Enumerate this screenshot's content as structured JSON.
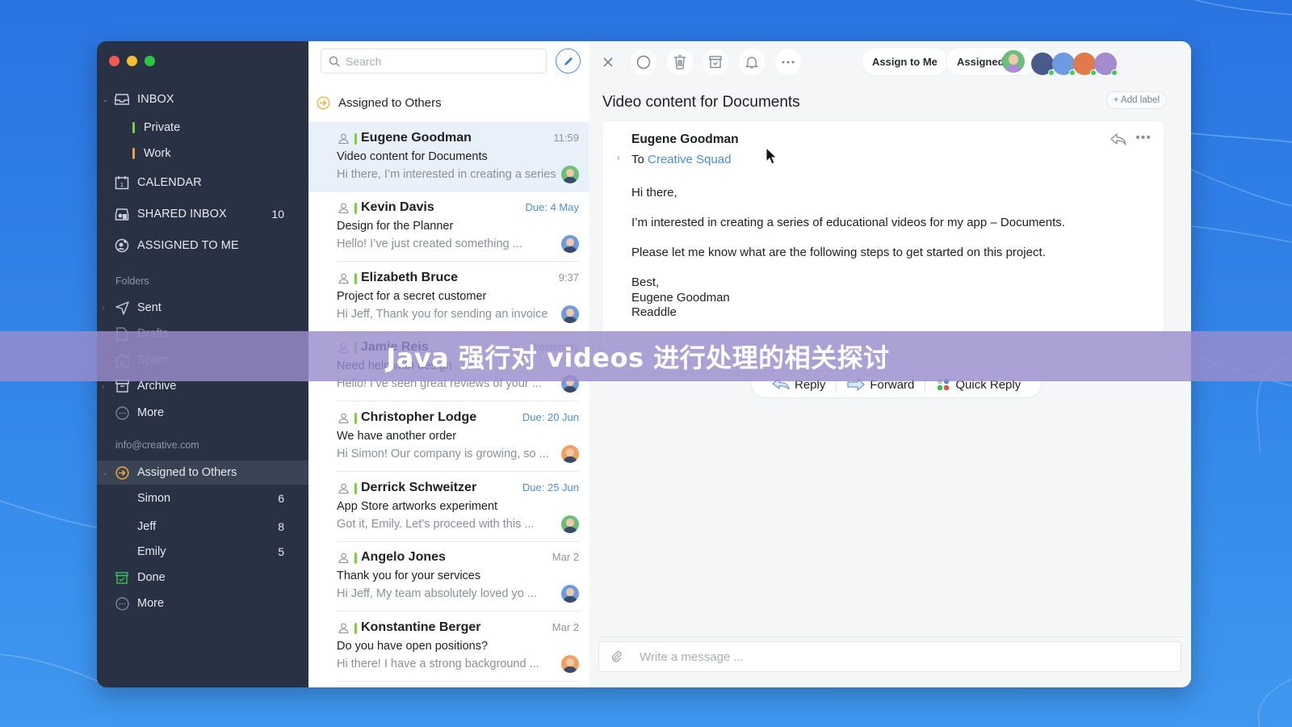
{
  "window": {
    "traffic_lights": [
      "close",
      "minimize",
      "maximize"
    ]
  },
  "sidebar": {
    "main": [
      {
        "label": "INBOX",
        "icon": "inbox-icon",
        "expanded": true
      },
      {
        "label": "Private",
        "tag_color": "#7fcf3a"
      },
      {
        "label": "Work",
        "tag_color": "#f0a03a"
      },
      {
        "label": "CALENDAR",
        "icon": "calendar-icon"
      },
      {
        "label": "SHARED INBOX",
        "icon": "shared-inbox-icon",
        "count": "10"
      },
      {
        "label": "ASSIGNED TO ME",
        "icon": "assigned-to-me-icon"
      }
    ],
    "folders_title": "Folders",
    "folders": [
      {
        "label": "Sent",
        "icon": "send-icon"
      },
      {
        "label": "Drafts",
        "icon": "draft-icon"
      },
      {
        "label": "Spam",
        "icon": "spam-icon"
      },
      {
        "label": "Archive",
        "icon": "archive-icon"
      },
      {
        "label": "More",
        "icon": "more-circle-icon"
      }
    ],
    "account_title": "info@creative.com",
    "account": [
      {
        "label": "Assigned to Others",
        "icon": "assigned-others-icon",
        "active": true
      },
      {
        "label": "Simon",
        "count": "6"
      },
      {
        "label": "Jeff",
        "count": "8"
      },
      {
        "label": "Emily",
        "count": "5"
      },
      {
        "label": "Done",
        "icon": "done-icon"
      },
      {
        "label": "More",
        "icon": "more-circle-icon"
      }
    ]
  },
  "list": {
    "search_placeholder": "Search",
    "header": "Assigned to Others",
    "messages": [
      {
        "name": "Eugene Goodman",
        "time": "11:59",
        "due": false,
        "subject": "Video content for Documents",
        "preview": "Hi there, I’m interested in creating a series",
        "selected": true,
        "avatar_color": "#6bbf7a"
      },
      {
        "name": "Kevin Davis",
        "time": "Due: 4 May",
        "due": true,
        "subject": "Design for the Planner",
        "preview": "Hello! I’ve just created something ...",
        "avatar_color": "#6e9be0"
      },
      {
        "name": "Elizabeth Bruce",
        "time": "9:37",
        "due": false,
        "subject": "Project for a secret customer",
        "preview": "Hi Jeff, Thank you for sending an invoice",
        "avatar_color": "#6e9be0"
      },
      {
        "name": "Jamie Reis",
        "time": "Yesterday",
        "due": false,
        "subject": "Need help with design",
        "preview": "Hello! I’ve seen great reviews of your ...",
        "avatar_color": "#6e9be0"
      },
      {
        "name": "Christopher Lodge",
        "time": "Due: 20 Jun",
        "due": true,
        "subject": "We have another order",
        "preview": "Hi Simon! Our company is growing, so ...",
        "avatar_color": "#f0a060"
      },
      {
        "name": "Derrick Schweitzer",
        "time": "Due: 25 Jun",
        "due": true,
        "subject": "App Store artworks experiment",
        "preview": "Got it, Emily. Let’s proceed with this ...",
        "avatar_color": "#6bbf7a"
      },
      {
        "name": "Angelo Jones",
        "time": "Mar 2",
        "due": false,
        "subject": "Thank you for your services",
        "preview": "Hi Jeff, My team absolutely loved yo ...",
        "avatar_color": "#6e9be0"
      },
      {
        "name": "Konstantine Berger",
        "time": "Mar 2",
        "due": false,
        "subject": "Do you have open positions?",
        "preview": "Hi there! I have a strong background ...",
        "avatar_color": "#f0a060"
      }
    ]
  },
  "detail": {
    "toolbar": {
      "close_icon": "close-icon",
      "mark_icon": "circle-icon",
      "delete_icon": "trash-icon",
      "archive_icon": "archive-icon",
      "remind_icon": "bell-icon",
      "more_icon": "more-icon",
      "assign_to_me": "Assign to Me",
      "assigned": "Assigned"
    },
    "assignee_colors": [
      "#6bbf7a",
      "#4a5a8a",
      "#6e9be0",
      "#e07a4a",
      "#a58ad0"
    ],
    "subject": "Video content for Documents",
    "add_label": "+ Add label",
    "from": "Eugene Goodman",
    "to_prefix": "To",
    "to": "Creative Squad",
    "body": [
      "Hi there,",
      "I’m interested in creating a series of educational videos for my app – Documents.",
      "Please let me know what are the following steps to get started on this project."
    ],
    "signature": [
      "Best,",
      "Eugene Goodman",
      "Readdle"
    ],
    "actions": {
      "reply": "Reply",
      "forward": "Forward",
      "quick_reply": "Quick Reply"
    },
    "composer_placeholder": "Write a message ..."
  },
  "overlay": {
    "caption": "Java 强行对 videos 进行处理的相关探讨"
  }
}
